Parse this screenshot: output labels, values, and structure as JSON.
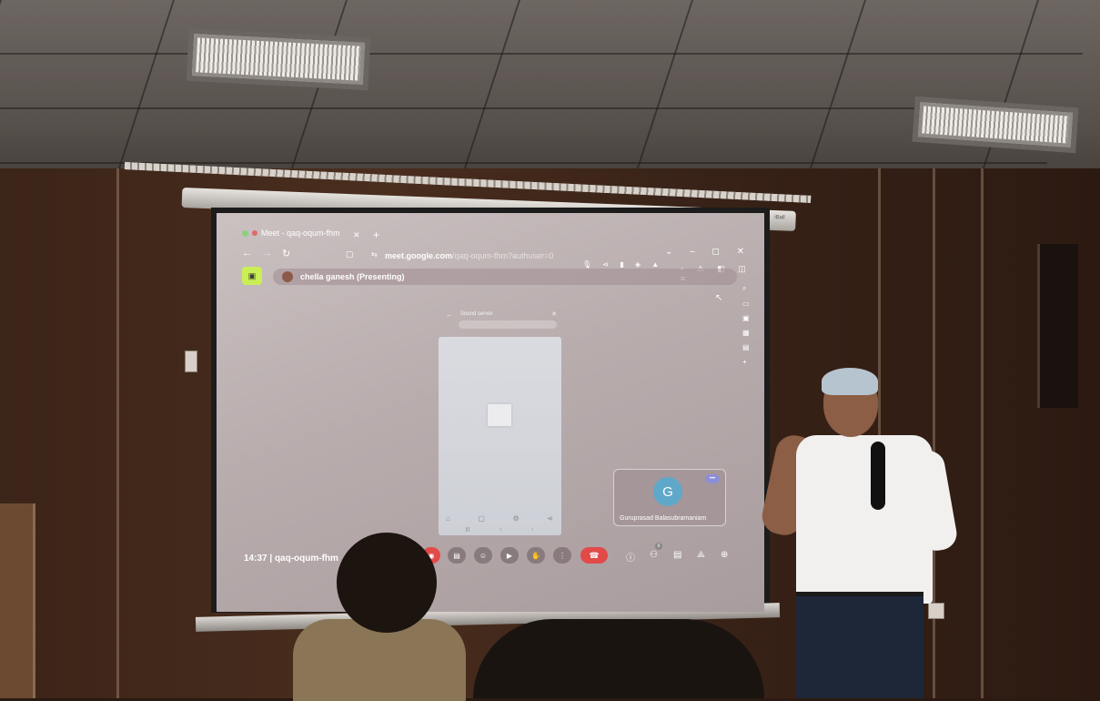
{
  "browser": {
    "tab_title": "Meet - qaq-oqum-fhm",
    "url_host": "meet.google.com",
    "url_path": "/qaq-oqum-fhm?authuser=0"
  },
  "meet": {
    "presenter_label": "chella ganesh (Presenting)",
    "shared_app_title": "Sound server",
    "self_tile_initial": "G",
    "self_tile_name": "Guruprasad Balasubramaniam",
    "self_more": "•••",
    "clock": "14:37",
    "meeting_code": "qaq-oqum-fhm",
    "participant_count": "6"
  },
  "projector": {
    "brand": "iBall"
  },
  "icons": {
    "back": "arrow-left-icon",
    "forward": "arrow-right-icon",
    "reload": "reload-icon",
    "hangup": "phone-hangup-icon",
    "info": "info-icon",
    "people": "people-icon",
    "chat": "chat-icon",
    "activities": "shapes-icon",
    "host": "lock-person-icon"
  },
  "colors": {
    "screen_bg": "#b8acad",
    "meet_logo": "#c9ef55",
    "hangup": "#e24a4a",
    "avatar": "#5fa8c9"
  }
}
